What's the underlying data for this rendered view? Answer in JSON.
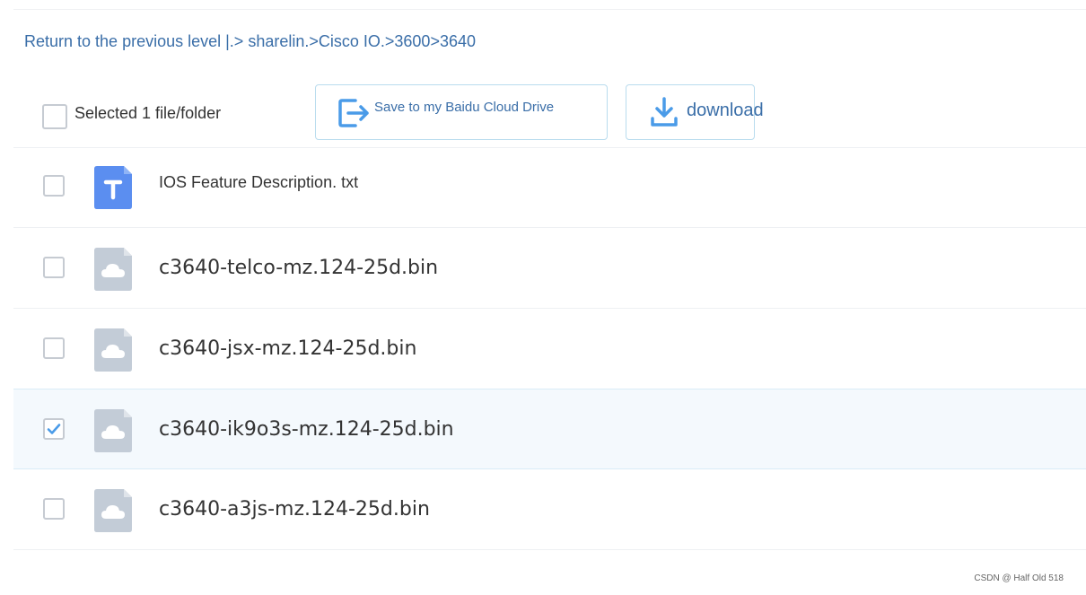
{
  "breadcrumb": {
    "back_label": "Return to the previous level",
    "separator": " |.> ",
    "path": "sharelin.>Cisco IO.>3600>3640"
  },
  "toolbar": {
    "selection_text": "Selected 1 file/folder",
    "save_label": "Save to my Baidu Cloud Drive",
    "download_label": "download"
  },
  "files": [
    {
      "name": "IOS Feature Description. txt",
      "icon": "text-file-icon",
      "checked": false
    },
    {
      "name": "c3640-telco-mz.124-25d.bin",
      "icon": "cloud-file-icon",
      "checked": false
    },
    {
      "name": "c3640-jsx-mz.124-25d.bin",
      "icon": "cloud-file-icon",
      "checked": false
    },
    {
      "name": "c3640-ik9o3s-mz.124-25d.bin",
      "icon": "cloud-file-icon",
      "checked": true
    },
    {
      "name": "c3640-a3js-mz.124-25d.bin",
      "icon": "cloud-file-icon",
      "checked": false
    }
  ],
  "watermark": "CSDN @ Half Old 518",
  "colors": {
    "accent": "#3a6ea8",
    "icon_blue": "#4a9be8",
    "text_file": "#5b8ef0",
    "generic_file": "#c3ccd7",
    "selected_row": "#f4f9fd"
  }
}
